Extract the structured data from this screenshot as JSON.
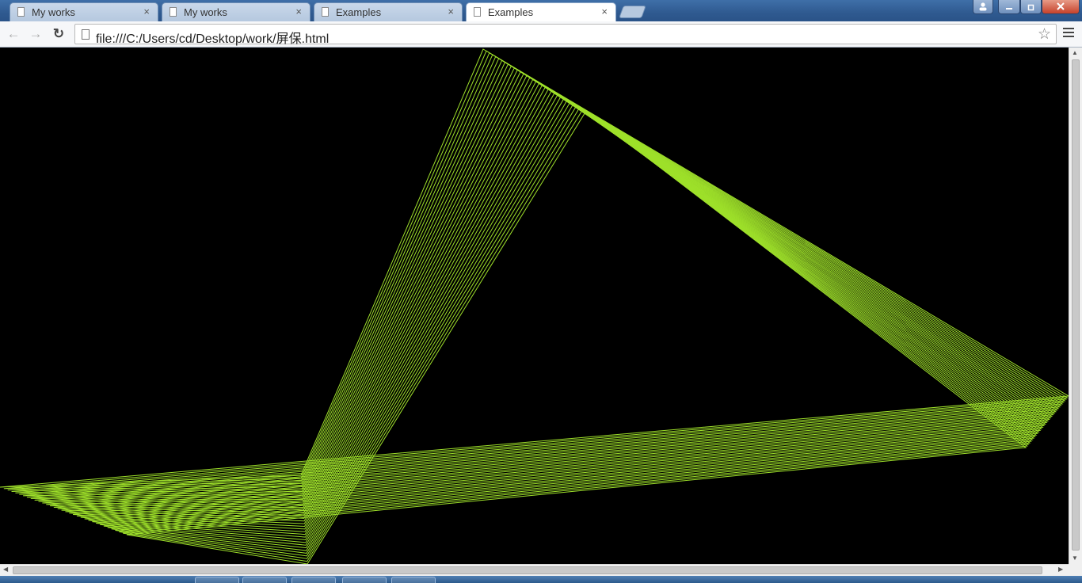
{
  "tabs": [
    {
      "title": "My works",
      "active": false
    },
    {
      "title": "My works",
      "active": false
    },
    {
      "title": "Examples",
      "active": false
    },
    {
      "title": "Examples",
      "active": true
    }
  ],
  "tab_close_glyph": "×",
  "window_controls": {
    "user": "user-icon",
    "minimize": "minimize-icon",
    "maximize": "maximize-icon",
    "close": "close-icon"
  },
  "toolbar": {
    "back": "←",
    "forward": "→",
    "reload": "↻",
    "url": "file:///C:/Users/cd/Desktop/work/屏保.html",
    "bookmark_star": "☆"
  },
  "scroll": {
    "up": "▲",
    "down": "▼",
    "left": "◀",
    "right": "▶"
  },
  "content": {
    "background": "#000000",
    "line_color": "#9ee02a",
    "description": "ribbon-line screensaver"
  }
}
